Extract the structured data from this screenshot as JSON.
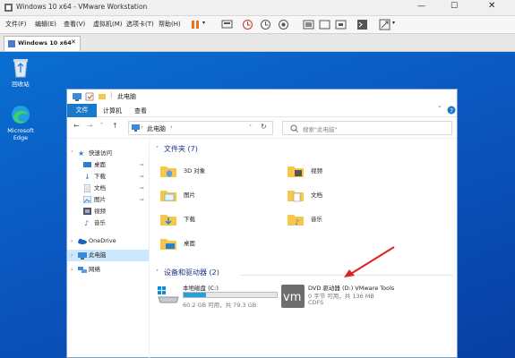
{
  "vmware": {
    "title": "Windows 10 x64 - VMware Workstation",
    "menu": [
      "文件(F)",
      "编辑(E)",
      "查看(V)",
      "虚拟机(M)",
      "选项卡(T)",
      "帮助(H)"
    ],
    "tab_label": "Windows 10 x64"
  },
  "desktop": {
    "icons": [
      {
        "label": "回收站",
        "icon": "recycle-bin-icon"
      },
      {
        "label": "Microsoft Edge",
        "icon": "edge-icon"
      }
    ]
  },
  "explorer": {
    "title": "此电脑",
    "ribbon": {
      "file": "文件",
      "tabs": [
        "计算机",
        "查看"
      ]
    },
    "address": "此电脑",
    "search_placeholder": "搜索\"此电脑\"",
    "nav": {
      "quick_access": "快速访问",
      "quick_items": [
        "桌面",
        "下载",
        "文档",
        "图片",
        "视频",
        "音乐"
      ],
      "onedrive": "OneDrive",
      "this_pc": "此电脑",
      "network": "网络"
    },
    "folders_header": "文件夹 (7)",
    "folders": [
      "3D 对象",
      "视频",
      "图片",
      "文档",
      "下载",
      "音乐",
      "桌面"
    ],
    "devices_header": "设备和驱动器 (2)",
    "drives": [
      {
        "name": "本地磁盘 (C:)",
        "detail": "60.2 GB 可用，共 79.3 GB",
        "used_fraction": 0.24
      },
      {
        "name": "DVD 驱动器 (D:) VMware Tools",
        "detail": "0 字节 可用，共 136 MB",
        "fs": "CDFS"
      }
    ]
  },
  "colors": {
    "accent": "#1979ca",
    "desktop": "#0a57bf",
    "arrow": "#e02020",
    "folder": "#f5c84c"
  }
}
